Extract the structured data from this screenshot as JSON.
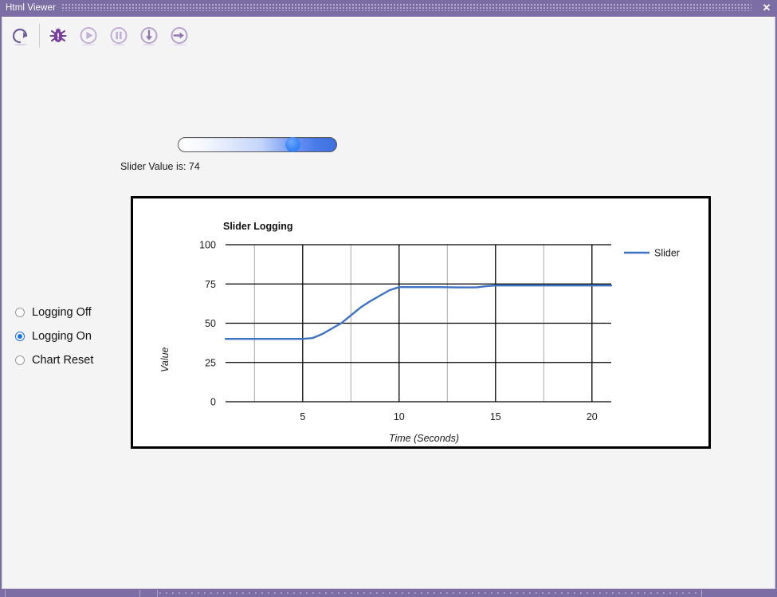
{
  "window": {
    "title": "Html Viewer",
    "close_label": "✕"
  },
  "toolbar": {
    "buttons": [
      {
        "name": "restart-icon",
        "tooltip": "Restart"
      },
      {
        "name": "debug-bug-icon",
        "tooltip": "Debug"
      },
      {
        "name": "run-icon",
        "tooltip": "Run"
      },
      {
        "name": "pause-icon",
        "tooltip": "Pause"
      },
      {
        "name": "step-into-icon",
        "tooltip": "Step Into"
      },
      {
        "name": "step-over-icon",
        "tooltip": "Step Over"
      }
    ],
    "accent_color": "#7c6da4",
    "muted_color": "#c7b6d8"
  },
  "slider": {
    "value": 74,
    "min": 0,
    "max": 100,
    "value_label": "Slider Value is: 74",
    "thumb_color": "#3a86f7",
    "track_end_color": "#3f6fe0"
  },
  "radios": {
    "options": [
      {
        "label": "Logging Off",
        "checked": false
      },
      {
        "label": "Logging On",
        "checked": true
      },
      {
        "label": "Chart Reset",
        "checked": false
      }
    ],
    "checked_color": "#1a73e8"
  },
  "chart_data": {
    "type": "line",
    "title": "Slider Logging",
    "xlabel": "Time (Seconds)",
    "ylabel": "Value",
    "xlim": [
      1,
      21
    ],
    "ylim": [
      0,
      100
    ],
    "xticks": [
      5,
      10,
      15,
      20
    ],
    "yticks": [
      0,
      25,
      50,
      75,
      100
    ],
    "minor_xticks": [
      2.5,
      7.5,
      12.5,
      17.5
    ],
    "grid": true,
    "legend": [
      "Slider"
    ],
    "legend_position": "right",
    "line_color": "#3d72c4",
    "series": [
      {
        "name": "Slider",
        "x": [
          1,
          2,
          3,
          4,
          5,
          5.5,
          6,
          6.5,
          7,
          7.5,
          8,
          8.5,
          9,
          9.5,
          10,
          11,
          12,
          13,
          14,
          14.5,
          15,
          16,
          17,
          18,
          19,
          20,
          21
        ],
        "values": [
          40,
          40,
          40,
          40,
          40,
          40.5,
          43,
          46.5,
          50,
          55,
          60,
          64,
          67.5,
          71,
          73,
          73,
          73,
          72.8,
          72.8,
          73.6,
          74,
          74,
          74,
          74,
          74,
          74,
          74
        ]
      }
    ]
  }
}
